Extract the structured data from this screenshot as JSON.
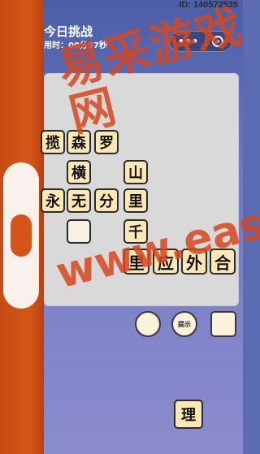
{
  "header": {
    "id_label": "ID: 140572535",
    "title": "今日挑战",
    "timer_label": "用时：",
    "timer_value": "00分57秒"
  },
  "capsule": {
    "more_icon": "ellipsis-icon",
    "close_icon": "target-close-icon"
  },
  "board": {
    "tiles": [
      {
        "char": "揽"
      },
      {
        "char": "森"
      },
      {
        "char": "罗"
      },
      {
        "char": "横"
      },
      {
        "char": "山"
      },
      {
        "char": "永"
      },
      {
        "char": "无"
      },
      {
        "char": "分"
      },
      {
        "char": "里"
      },
      {
        "char": ""
      },
      {
        "char": "千"
      },
      {
        "char": "里"
      },
      {
        "char": "应"
      },
      {
        "char": "外"
      },
      {
        "char": "合"
      }
    ]
  },
  "tools": {
    "tool1_label": "",
    "tool2_label": "提示",
    "tool3_label": ""
  },
  "candidate": {
    "char": "理"
  },
  "watermark": {
    "line1": "易采游戏网",
    "line2": "www.eastck.net"
  }
}
